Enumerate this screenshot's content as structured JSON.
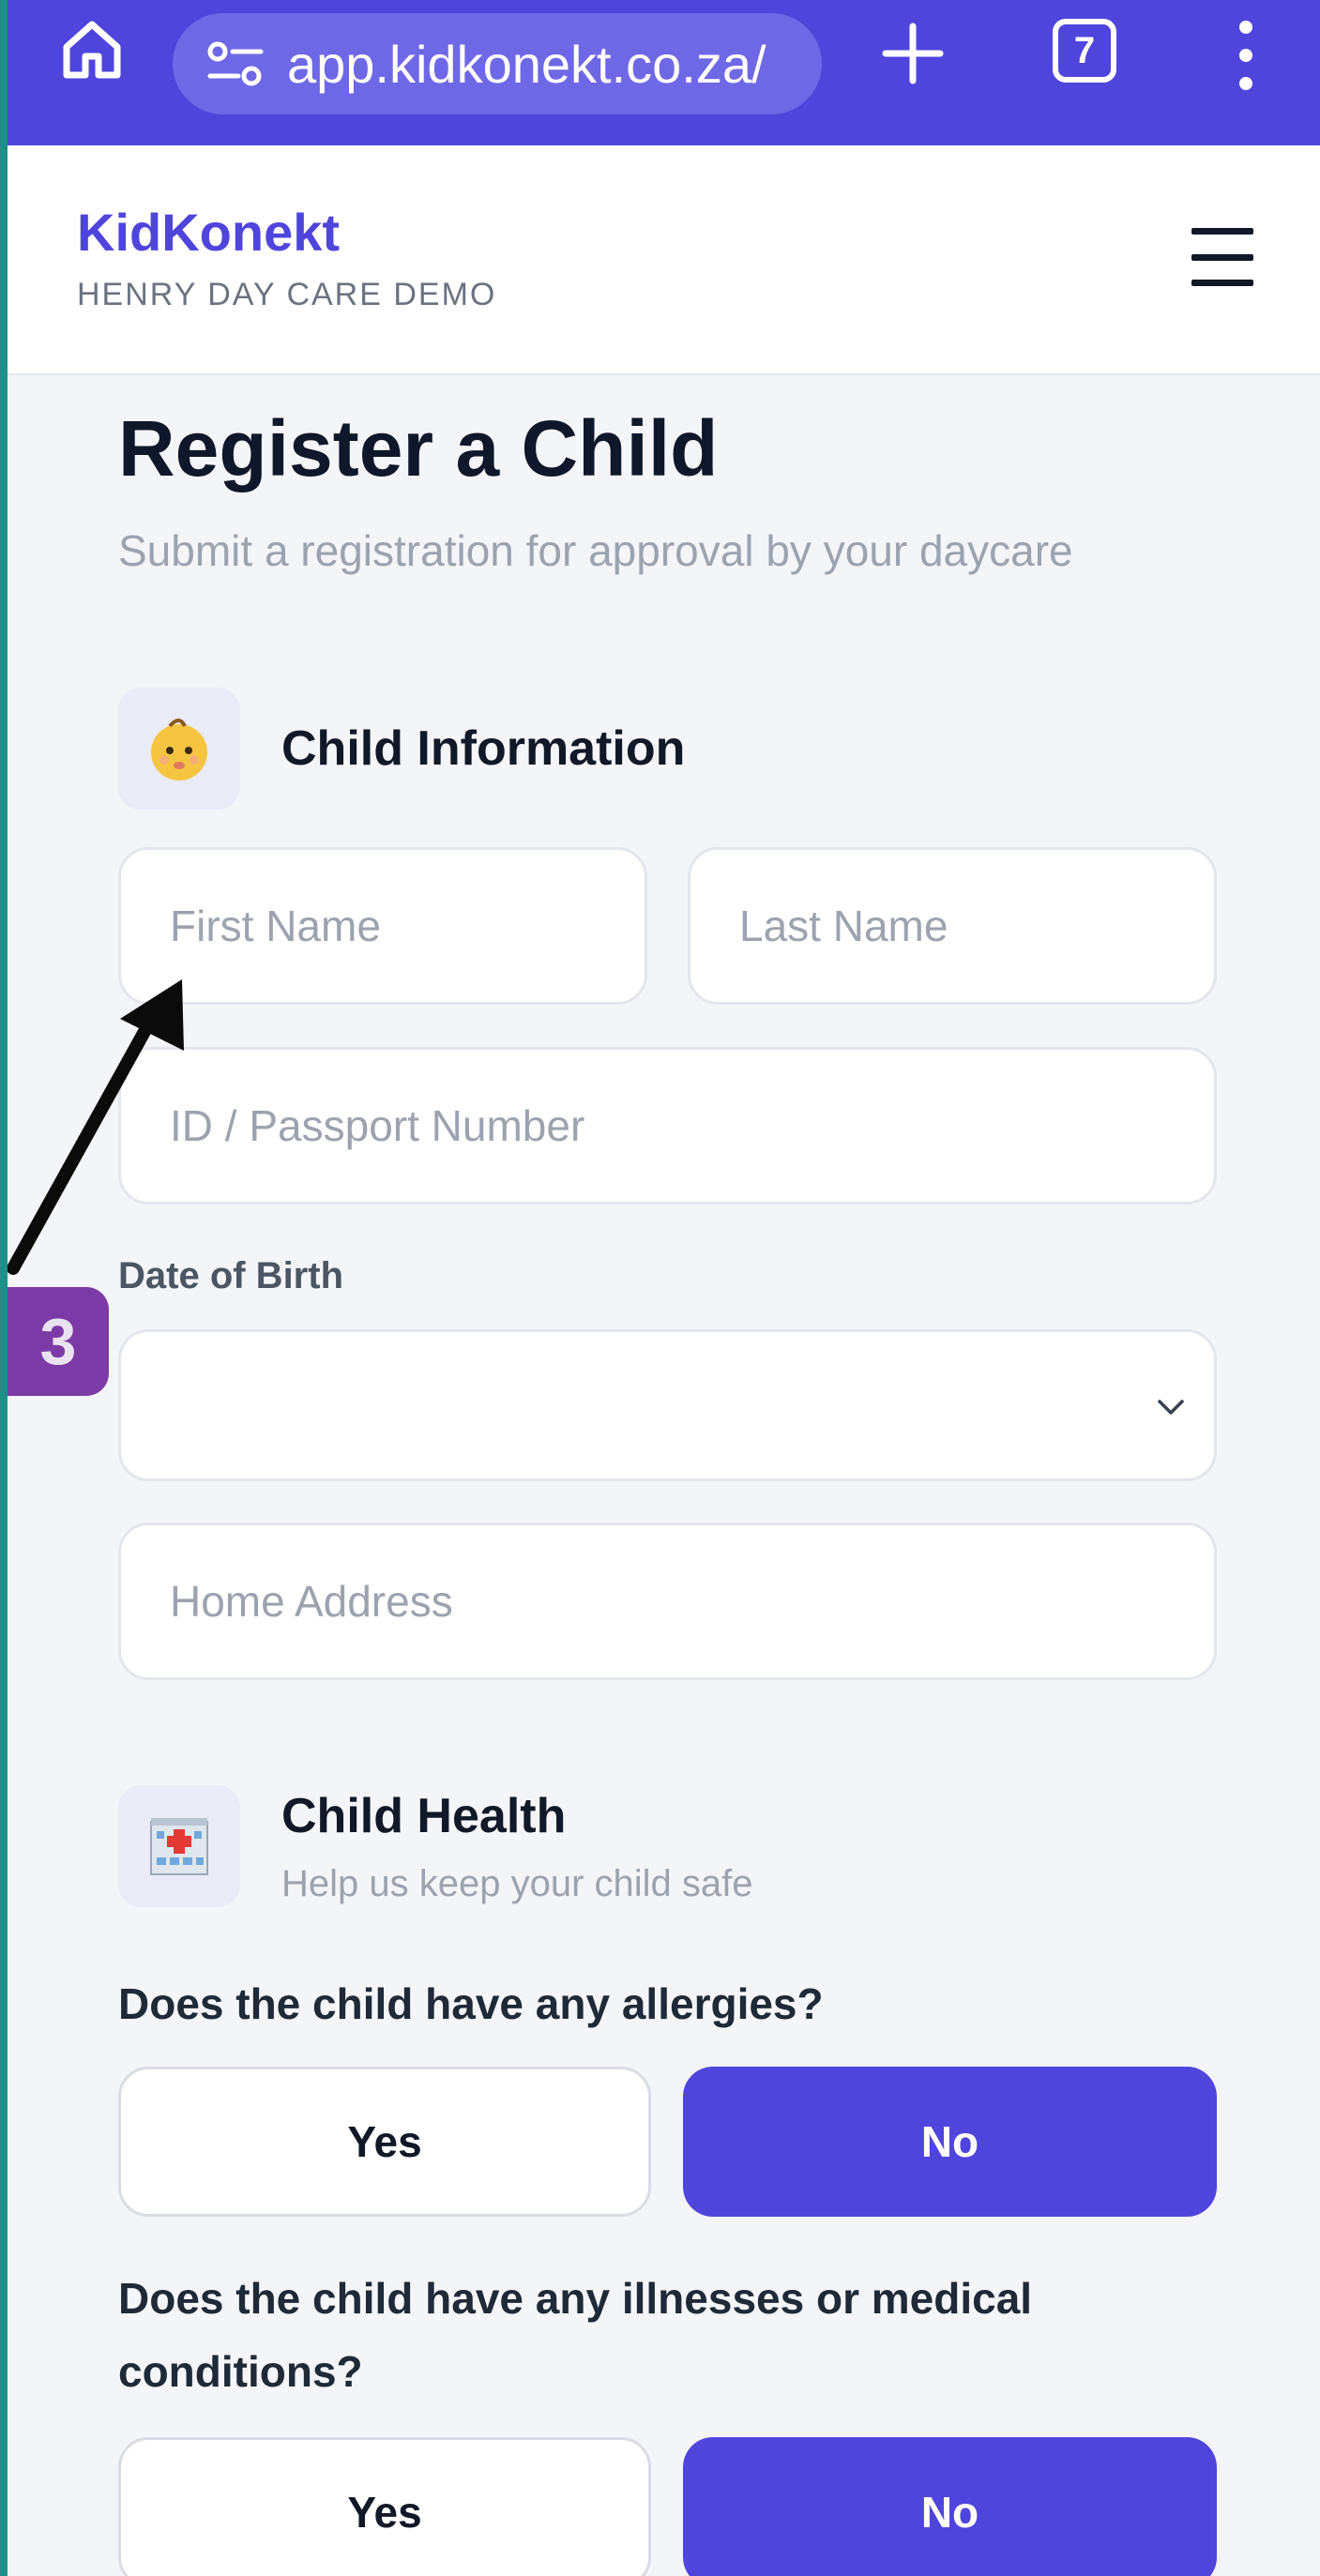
{
  "browser": {
    "url": "app.kidkonekt.co.za/",
    "tab_count": "7"
  },
  "header": {
    "brand": "KidKonekt",
    "subtitle": "HENRY DAY CARE DEMO"
  },
  "page": {
    "title": "Register a Child",
    "subtitle": "Submit a registration for approval by your daycare"
  },
  "child_info": {
    "title": "Child Information",
    "icon": "baby-face-icon",
    "first_name_placeholder": "First Name",
    "last_name_placeholder": "Last Name",
    "id_placeholder": "ID / Passport Number",
    "dob_label": "Date of Birth",
    "dob_value": "",
    "address_placeholder": "Home Address"
  },
  "child_health": {
    "title": "Child Health",
    "subtitle": "Help us keep your child safe",
    "icon": "hospital-icon",
    "q_allergies": "Does the child have any allergies?",
    "q_illness": "Does the child have any illnesses or medical conditions?",
    "yes_label": "Yes",
    "no_label": "No",
    "allergies_selected": "No",
    "illness_selected": "No"
  },
  "annotation": {
    "step": "3"
  },
  "colors": {
    "primary": "#4f45dc",
    "badge": "#7c3aa6"
  }
}
